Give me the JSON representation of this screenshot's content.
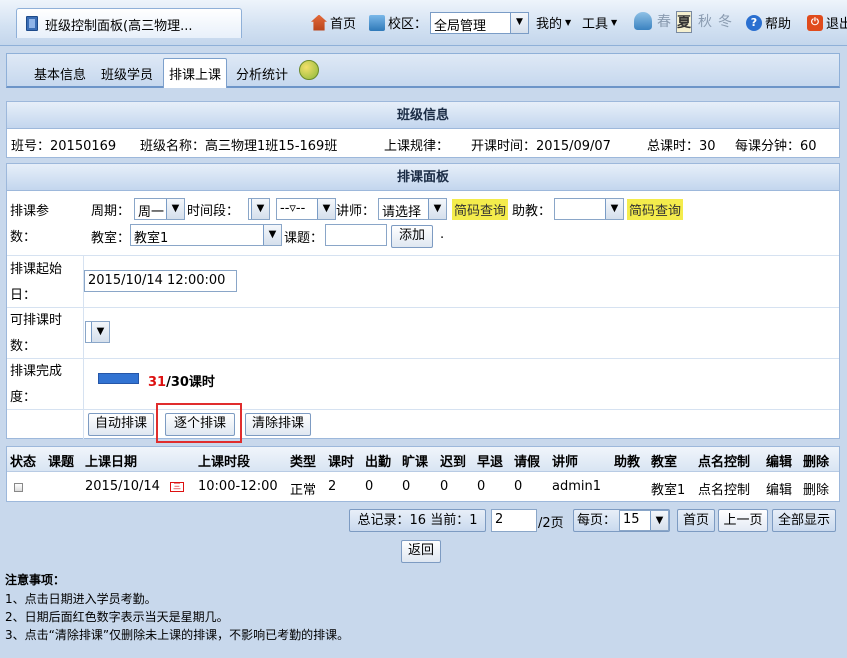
{
  "window": {
    "tab_title": "班级控制面板(高三物理..."
  },
  "topnav": {
    "home": "首页",
    "campus_label": "校区：",
    "campus_value": "全局管理",
    "mine": "我的",
    "tools": "工具",
    "seasons": [
      "春",
      "夏",
      "秋",
      "冬"
    ],
    "active_season": "夏",
    "help": "帮助",
    "exit": "退出"
  },
  "tabs": [
    "基本信息",
    "班级学员",
    "排课上课",
    "分析统计"
  ],
  "active_tab": "排课上课",
  "class_info": {
    "title": "班级信息",
    "class_no": "班号：20150169",
    "class_name": "班级名称：高三物理1班15-169班",
    "rule": "上课规律：",
    "start_date": "开课时间：2015/09/07",
    "total_lessons": "总课时：30",
    "minutes_per": "每课分钟：60"
  },
  "panel": {
    "title": "排课面板",
    "params_label": [
      "排课参",
      "数："
    ],
    "period_label": "周期：",
    "period_value": "周一",
    "timeslot_label": "时间段：",
    "timeslot_value": "",
    "timeslot2_value": "--▿--",
    "teacher_label": "讲师：",
    "teacher_value": "请选择",
    "code_query": "简码查询",
    "assistant_label": "助教：",
    "assistant_value": "",
    "classroom_label": "教室：",
    "classroom_value": "教室1",
    "topic_label": "课题：",
    "topic_value": "",
    "add_button": "添加",
    "dot": ".",
    "start_label": [
      "排课起始",
      "日："
    ],
    "start_value": "2015/10/14 12:00:00",
    "avail_label": [
      "可排课时",
      "数："
    ],
    "progress_label": [
      "排课完成",
      "度："
    ],
    "progress_done": "31",
    "progress_total": "/30课时",
    "progress_fraction": 1.0,
    "auto_button": "自动排课",
    "single_button": "逐个排课",
    "clear_button": "清除排课"
  },
  "table": {
    "headers": [
      "状态",
      "课题",
      "上课日期",
      "上课时段",
      "类型",
      "课时",
      "出勤",
      "旷课",
      "迟到",
      "早退",
      "请假",
      "讲师",
      "助教",
      "教室",
      "点名控制",
      "编辑",
      "删除"
    ],
    "rows": [
      {
        "date": "2015/10/14",
        "weekday_mark": "三",
        "time": "10:00-12:00",
        "type": "正常",
        "hours": "2",
        "present": "0",
        "absent": "0",
        "late": "0",
        "early": "0",
        "leave": "0",
        "teacher": "admin1",
        "assistant": "",
        "room": "教室1",
        "rollcall": "点名控制",
        "edit": "编辑",
        "delete": "删除"
      }
    ]
  },
  "pager": {
    "summary": "总记录：16 当前：1",
    "page_input": "2",
    "page_total": "/2页",
    "per_page_label": "每页：",
    "per_page_value": "15",
    "first": "首页",
    "prev": "上一页",
    "show_all": "全部显示"
  },
  "back_button": "返回",
  "notes": {
    "title": "注意事项：",
    "items": [
      "1、点击日期进入学员考勤。",
      "2、日期后面红色数字表示当天是星期几。",
      "3、点击“清除排课”仅删除未上课的排课，不影响已考勤的排课。"
    ]
  }
}
